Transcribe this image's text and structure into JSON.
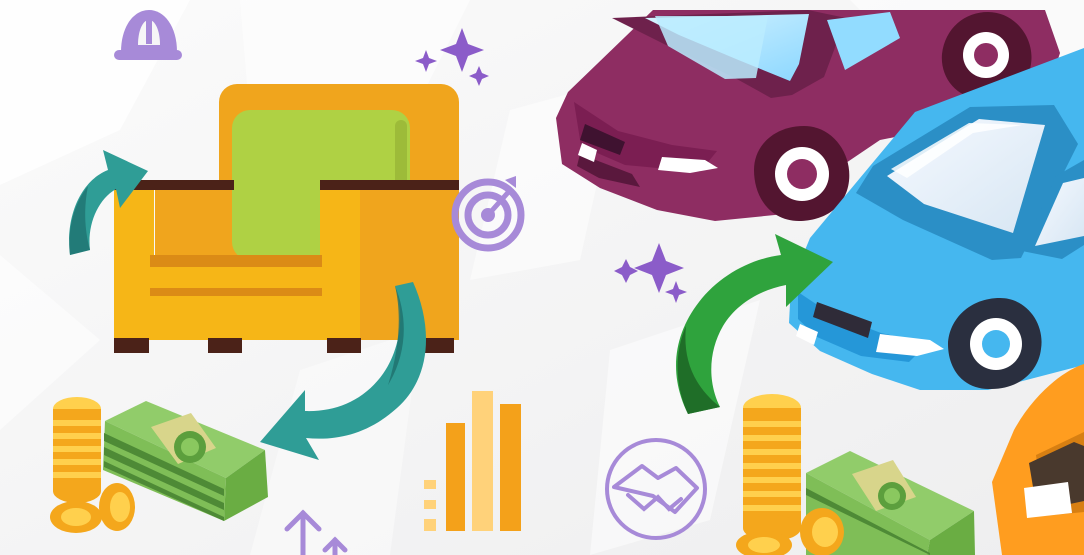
{
  "palette": {
    "background": "#f6f6f7",
    "sofa_frame": "#f0a51d",
    "sofa_arm": "#f6b617",
    "sofa_cushion": "#afd144",
    "sofa_trim": "#4b2218",
    "teal_arrow": "#2f9d96",
    "teal_arrow_dark": "#1f706d",
    "green_arrow": "#2fa33d",
    "green_arrow_dark": "#1f6e28",
    "purple_car": "#8e2d62",
    "purple_car_dark": "#6e214c",
    "blue_car": "#45b7ef",
    "blue_car_dark": "#2b8fc6",
    "orange_car": "#ff9d1f",
    "cash_green": "#7fbe57",
    "cash_dark": "#4e8a36",
    "coin_gold": "#f4a71c",
    "coin_light": "#ffd04d",
    "lavender_icon": "#a78ad8",
    "bar_orange": "#f4a11a",
    "bar_light": "#ffd27a"
  },
  "icons": [
    "bell-icon",
    "sparkle-icon",
    "target-icon",
    "handshake-icon",
    "up-arrow-icon",
    "coin-stack-icon",
    "cash-stack-icon",
    "bar-chart-icon",
    "sofa-icon",
    "car-icon",
    "curved-arrow-icon"
  ]
}
